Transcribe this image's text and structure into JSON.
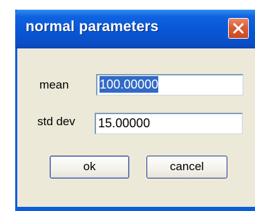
{
  "dialog": {
    "title": "normal parameters",
    "close_icon": "close-icon",
    "fields": {
      "mean": {
        "label": "mean",
        "value": "100.00000",
        "selected": true
      },
      "std_dev": {
        "label": "std dev",
        "value": "15.00000"
      }
    },
    "buttons": {
      "ok_label": "ok",
      "cancel_label": "cancel"
    }
  },
  "colors": {
    "titlebar": "#0757d4",
    "window_bg": "#ece9d8",
    "close_button": "#d85c35",
    "selection": "#316ac5"
  }
}
